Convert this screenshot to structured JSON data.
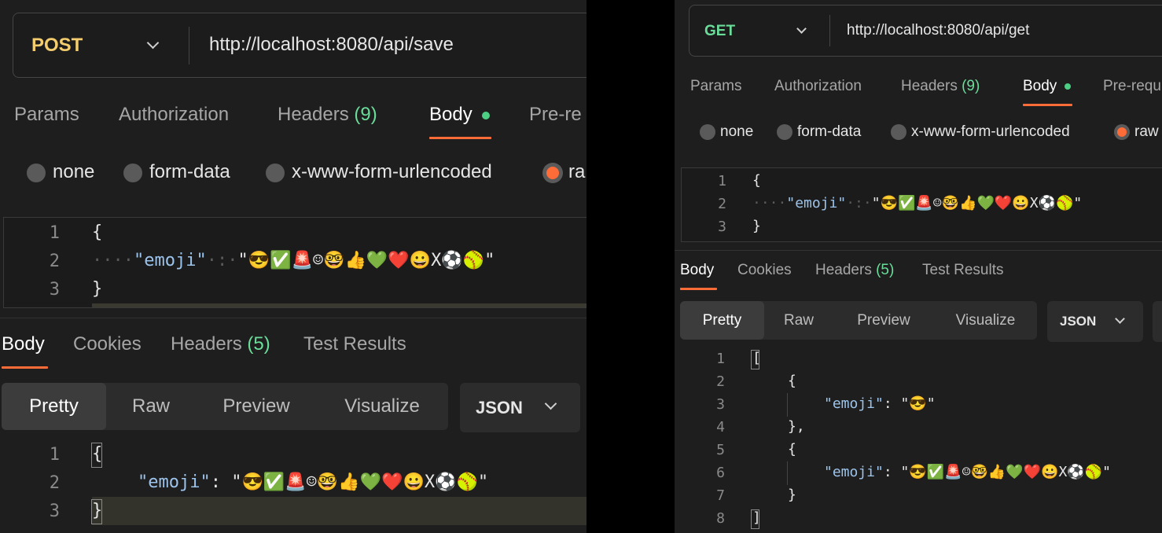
{
  "left": {
    "method": "POST",
    "url": "http://localhost:8080/api/save",
    "request_tabs": {
      "params": "Params",
      "authorization": "Authorization",
      "headers": "Headers",
      "headers_count": "(9)",
      "body": "Body",
      "pre_request": "Pre-re"
    },
    "body_types": {
      "none": "none",
      "form_data": "form-data",
      "urlencoded": "x-www-form-urlencoded",
      "raw": "ra"
    },
    "request_body": {
      "line_numbers": [
        "1",
        "2",
        "3"
      ],
      "line1": "{",
      "line2_ws": "····",
      "line2_key": "\"emoji\"",
      "line2_sep": "·:·",
      "line2_val": "\"😎✅🚨☺🤓👍💚❤️😀X⚽🥎\"",
      "line3": "}"
    },
    "response_tabs": {
      "body": "Body",
      "cookies": "Cookies",
      "headers": "Headers",
      "headers_count": "(5)",
      "test_results": "Test Results"
    },
    "view_modes": {
      "pretty": "Pretty",
      "raw": "Raw",
      "preview": "Preview",
      "visualize": "Visualize"
    },
    "format": "JSON",
    "response_body": {
      "line_numbers": [
        "1",
        "2",
        "3"
      ],
      "line1": "{",
      "line2_key": "\"emoji\"",
      "line2_sep": ": ",
      "line2_val": "\"😎✅🚨☺🤓👍💚❤️😀X⚽🥎\"",
      "line3": "}"
    }
  },
  "right": {
    "method": "GET",
    "url": "http://localhost:8080/api/get",
    "request_tabs": {
      "params": "Params",
      "authorization": "Authorization",
      "headers": "Headers",
      "headers_count": "(9)",
      "body": "Body",
      "pre_request": "Pre-requ"
    },
    "body_types": {
      "none": "none",
      "form_data": "form-data",
      "urlencoded": "x-www-form-urlencoded",
      "raw": "raw"
    },
    "request_body": {
      "line_numbers": [
        "1",
        "2",
        "3"
      ],
      "line1": "{",
      "line2_ws": "····",
      "line2_key": "\"emoji\"",
      "line2_sep": "·:·",
      "line2_val": "\"😎✅🚨☺🤓👍💚❤️😀X⚽🥎\"",
      "line3": "}"
    },
    "response_tabs": {
      "body": "Body",
      "cookies": "Cookies",
      "headers": "Headers",
      "headers_count": "(5)",
      "test_results": "Test Results"
    },
    "view_modes": {
      "pretty": "Pretty",
      "raw": "Raw",
      "preview": "Preview",
      "visualize": "Visualize"
    },
    "format": "JSON",
    "response_body": {
      "line_numbers": [
        "1",
        "2",
        "3",
        "4",
        "5",
        "6",
        "7",
        "8"
      ],
      "line1": "[",
      "line2": "{",
      "line3_key": "\"emoji\"",
      "line3_sep": ": ",
      "line3_val": "\"😎\"",
      "line4": "},",
      "line5": "{",
      "line6_key": "\"emoji\"",
      "line6_sep": ": ",
      "line6_val": "\"😎✅🚨☺🤓👍💚❤️😀X⚽🥎\"",
      "line7": "}",
      "line8": "]"
    }
  },
  "colors": {
    "accent": "#ff6c37",
    "post": "#f3cd6e",
    "get": "#6bdd9a",
    "dot": "#4cce84",
    "json_key": "#9cc4ec"
  }
}
